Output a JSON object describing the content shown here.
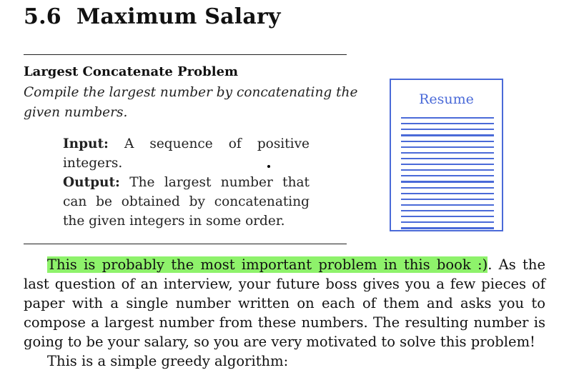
{
  "section": {
    "number": "5.6",
    "title": "Maximum Salary"
  },
  "problem": {
    "name": "Largest Concatenate Problem",
    "description": "Compile the largest number by concatenating the given numbers.",
    "input_label": "Input:",
    "input_text": "A sequence of positive integers.",
    "output_label": "Output:",
    "output_text": "The largest number that can be obtained by concatenating the given integers in some order."
  },
  "illustration": {
    "caption": "Resume",
    "text_lines": 20,
    "color": "#4a6ad8"
  },
  "body": {
    "highlighted_sentence": "This is probably the most important problem in this book :)",
    "highlight_color": "#8ef26b",
    "paragraph_1_rest": ". As the last question of an interview, your future boss gives you a few pieces of paper with a single number written on each of them and asks you to compose a largest number from these numbers. The resulting number is going to be your salary, so you are very motivated to solve this problem!",
    "paragraph_2": "This is a simple greedy algorithm:"
  }
}
